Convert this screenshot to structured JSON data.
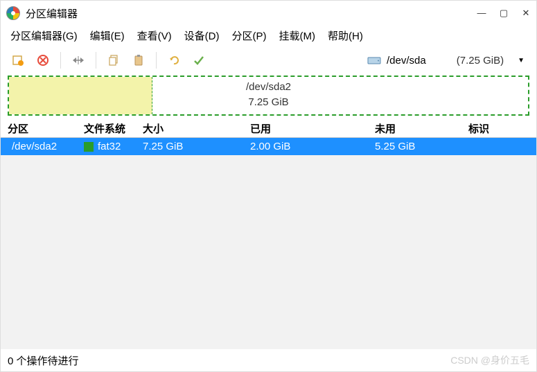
{
  "window": {
    "title": "分区编辑器"
  },
  "menu": {
    "items": [
      {
        "label": "分区编辑器(G)"
      },
      {
        "label": "编辑(E)"
      },
      {
        "label": "查看(V)"
      },
      {
        "label": "设备(D)"
      },
      {
        "label": "分区(P)"
      },
      {
        "label": "挂载(M)"
      },
      {
        "label": "帮助(H)"
      }
    ]
  },
  "toolbar": {
    "device": {
      "name": "/dev/sda",
      "size": "(7.25 GiB)"
    }
  },
  "partition_visual": {
    "name": "/dev/sda2",
    "size": "7.25 GiB",
    "used_percent": 27.6
  },
  "columns": {
    "partition": "分区",
    "filesystem": "文件系统",
    "size": "大小",
    "used": "已用",
    "free": "未用",
    "flags": "标识"
  },
  "rows": [
    {
      "partition": "/dev/sda2",
      "fs": "fat32",
      "size": "7.25 GiB",
      "used": "2.00 GiB",
      "free": "5.25 GiB",
      "flags": ""
    }
  ],
  "status": {
    "pending": "0 个操作待进行",
    "watermark": "CSDN @身价五毛"
  }
}
